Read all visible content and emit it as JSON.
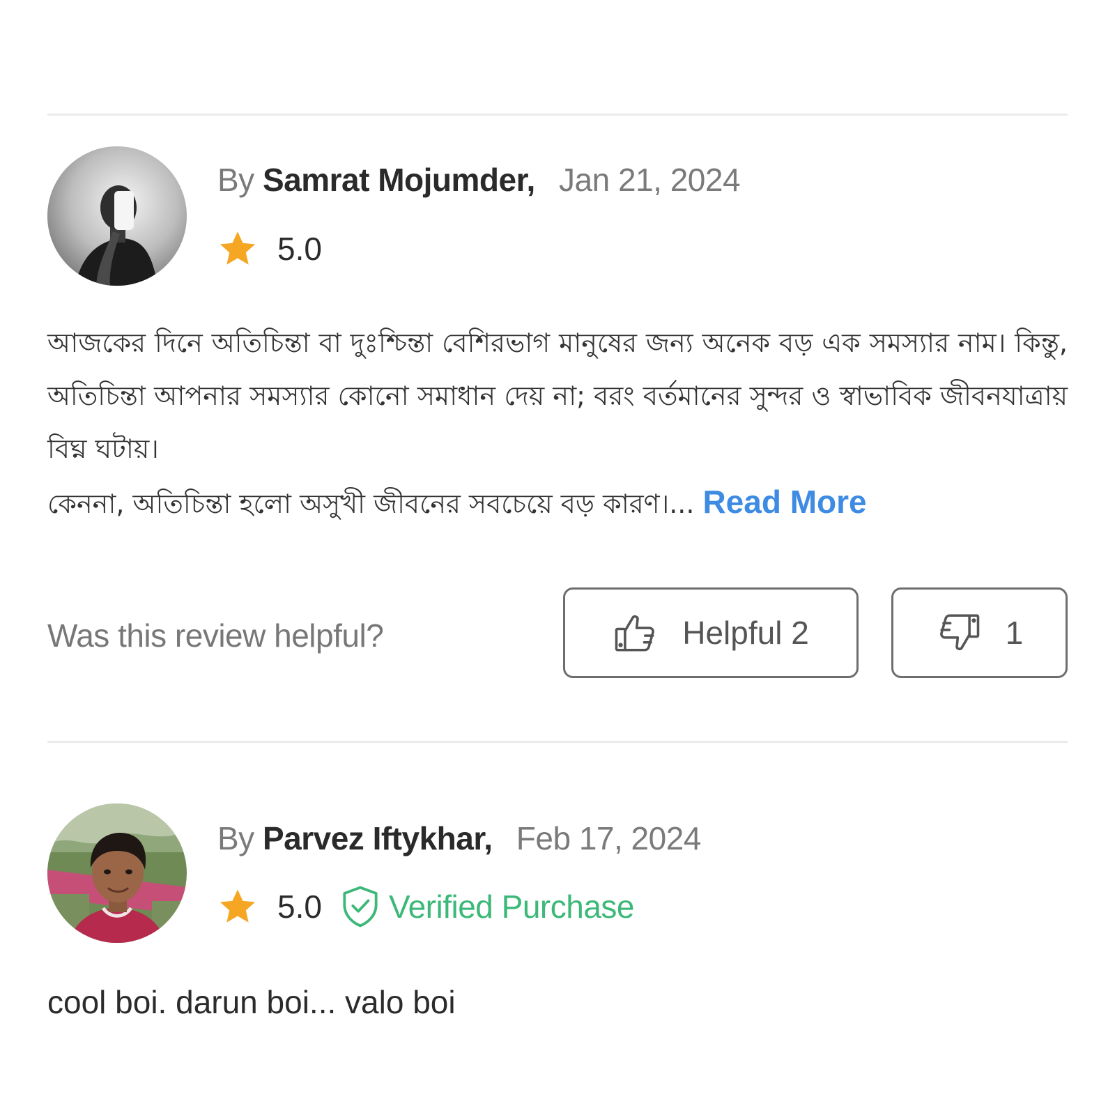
{
  "reviews": [
    {
      "by_prefix": "By",
      "author": "Samrat Mojumder",
      "date": "Jan 21, 2024",
      "rating": "5.0",
      "avatar_icon": "grayscale-portrait-avatar",
      "body_lines": [
        "আজকের দিনে অতিচিন্তা বা দুঃশ্চিন্তা বেশিরভাগ মানুষের জন্য অনেক বড় এক সমস্যার নাম। কিন্তু, অতিচিন্তা আপনার সমস্যার কোনো সমাধান দেয় না; বরং বর্তমানের সুন্দর ও স্বাভাবিক জীবনযাত্রায় বিঘ্ন ঘটায়।",
        "কেননা, অতিচিন্তা হলো অসুখী জীবনের সবচেয়ে বড় কারণ।..."
      ],
      "read_more_label": "Read More",
      "helpful_question": "Was this review helpful?",
      "helpful_label": "Helpful 2",
      "not_helpful_count": "1"
    },
    {
      "by_prefix": "By",
      "author": "Parvez Iftykhar",
      "date": "Feb 17, 2024",
      "rating": "5.0",
      "avatar_icon": "smiling-man-photo-avatar",
      "verified_label": "Verified Purchase",
      "body": "cool boi. darun boi... valo boi"
    }
  ],
  "colors": {
    "star": "#F5A623",
    "link": "#3D8BE3",
    "verified": "#3CB878",
    "divider": "#EBEBEB",
    "button_border": "#6E6E6E"
  },
  "icons": {
    "star": "star-icon",
    "verified": "shield-check-icon",
    "thumbs_up": "thumbs-up-icon",
    "thumbs_down": "thumbs-down-icon"
  }
}
